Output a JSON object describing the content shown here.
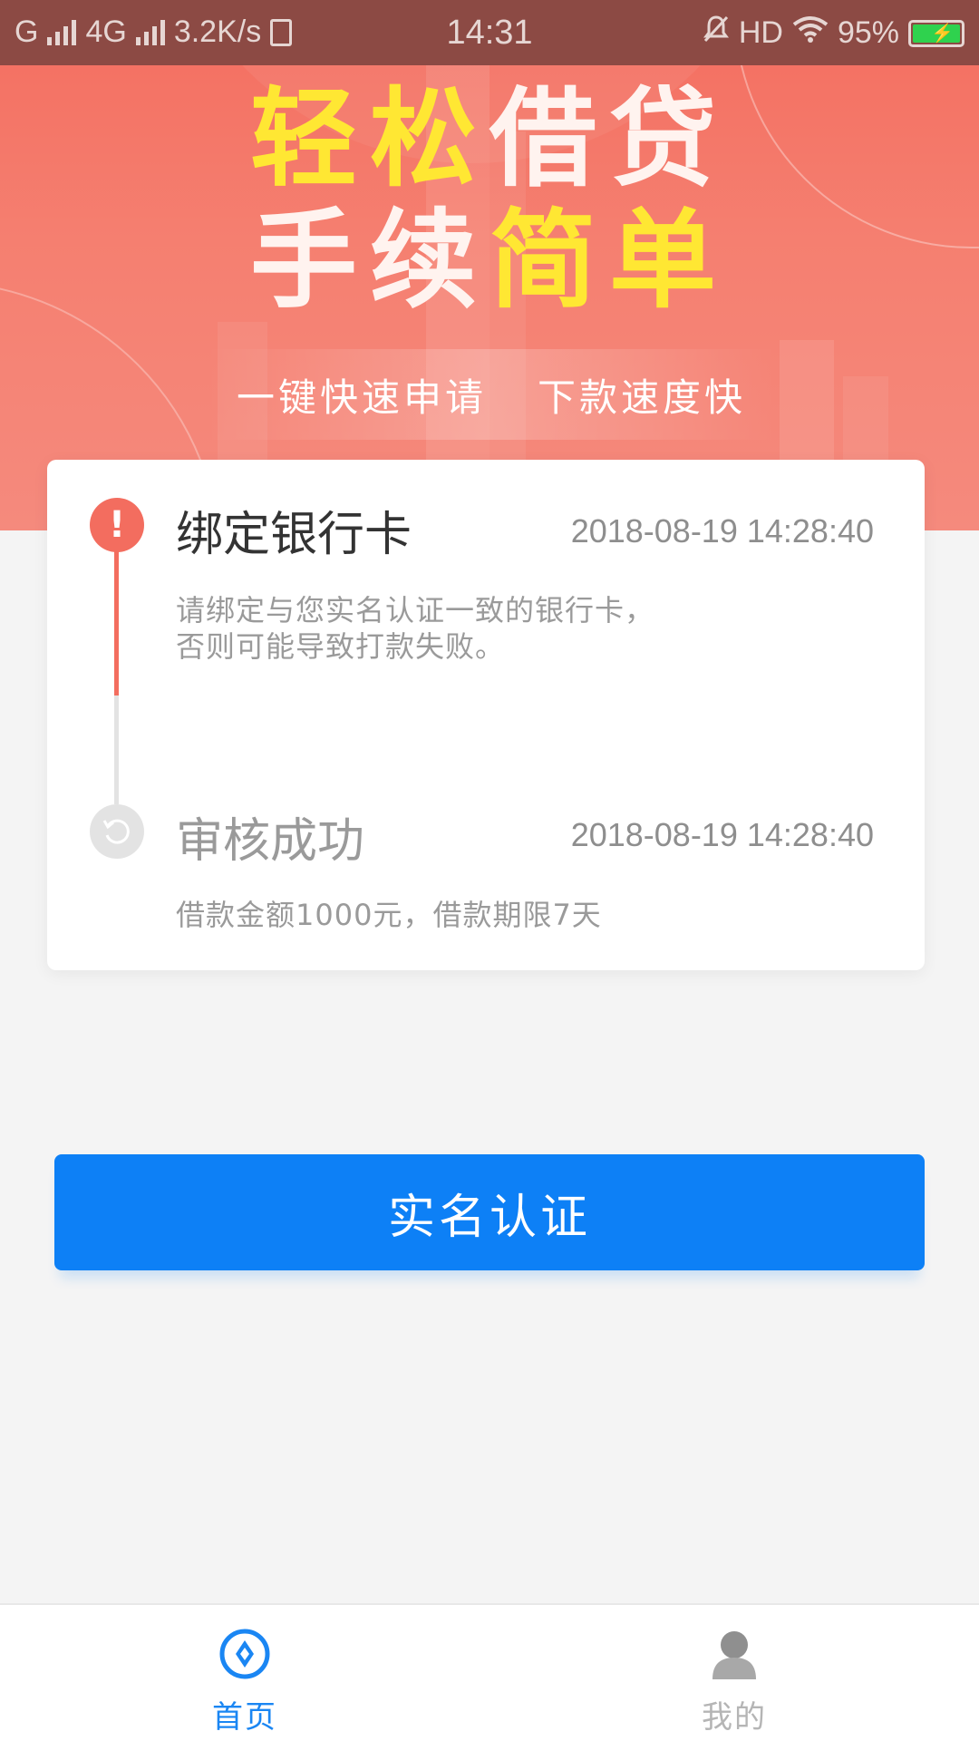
{
  "status_bar": {
    "carrier1": "G",
    "carrier2": "4G",
    "speed": "3.2K/s",
    "time": "14:31",
    "hd": "HD",
    "battery": "95%"
  },
  "banner": {
    "line1_yellow": "轻松",
    "line1_white": "借贷",
    "line2_white": "手续",
    "line2_yellow": "简单",
    "tag1": "一键快速申请",
    "tag2": "下款速度快"
  },
  "steps": [
    {
      "title": "绑定银行卡",
      "time": "2018-08-19 14:28:40",
      "desc": "请绑定与您实名认证一致的银行卡，否则可能导致打款失败。",
      "icon": "alert-icon"
    },
    {
      "title": "审核成功",
      "time": "2018-08-19 14:28:40",
      "desc": "借款金额1000元，借款期限7天",
      "icon": "refresh-icon"
    }
  ],
  "primary_button": {
    "label": "实名认证"
  },
  "bottom_nav": {
    "items": [
      {
        "label": "首页",
        "icon": "home-icon",
        "active": true
      },
      {
        "label": "我的",
        "icon": "user-icon",
        "active": false
      }
    ]
  },
  "colors": {
    "accent": "#f36d5f",
    "primary": "#0d80f6",
    "highlight": "#ffe733"
  }
}
